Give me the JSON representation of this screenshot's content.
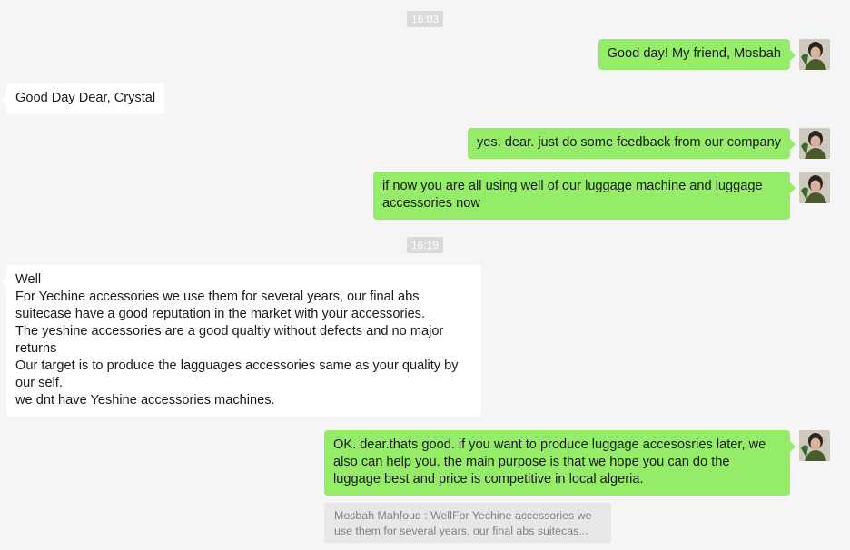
{
  "chat": {
    "timestamps": [
      "16:03",
      "16:19"
    ],
    "messages": [
      {
        "side": "out",
        "lines": [
          "Good day! My friend, Mosbah"
        ]
      },
      {
        "side": "in",
        "lines": [
          "Good Day Dear, Crystal"
        ]
      },
      {
        "side": "out",
        "lines": [
          "yes. dear. just do some feedback from our company"
        ]
      },
      {
        "side": "out",
        "lines": [
          "if now you are all using well of our luggage machine and luggage",
          "accessories  now"
        ]
      },
      {
        "side": "in",
        "lines": [
          "Well",
          "For Yechine accessories we use them for several years, our final abs",
          "suitecase have a good reputation in the market with your accessories.",
          "The yeshine accessories are a good qualtiy without defects and no major",
          "returns",
          "Our target is to produce the lagguages accessories same as your quality by",
          "our self.",
          "we dnt have Yeshine accessories machines."
        ]
      },
      {
        "side": "out",
        "lines": [
          "OK. dear.thats good. if you want to produce luggage accesosries later, we",
          "also can help you. the main purpose is that we hope you can do the",
          "luggage best and price is competitive in local algeria."
        ]
      }
    ],
    "quote": {
      "lines": [
        "Mosbah Mahfoud : WellFor Yechine accessories we",
        "use them for several years, our final abs suitecas..."
      ]
    }
  },
  "colors": {
    "background": "#f5f5f5",
    "outgoing_bubble": "#95ec69",
    "incoming_bubble": "#ffffff",
    "timestamp_bg": "#dadada",
    "quote_bg": "#e7e7e7"
  },
  "icons": {
    "avatar": "user-avatar-photo"
  }
}
